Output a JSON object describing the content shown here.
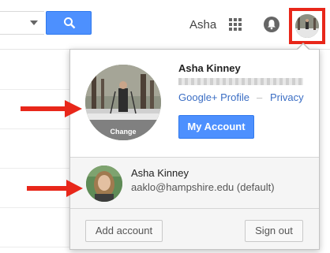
{
  "header": {
    "user_short": "Asha",
    "search_icon": "search-icon",
    "apps_icon": "apps-grid-icon",
    "notifications_icon": "bell-icon",
    "highlight_color": "#e8271a"
  },
  "account_popup": {
    "name": "Asha Kinney",
    "change_label": "Change",
    "gplus_link": "Google+ Profile",
    "separator": "–",
    "privacy_link": "Privacy",
    "my_account_label": "My Account",
    "accent_color": "#4d90fe"
  },
  "secondary_account": {
    "name": "Asha Kinney",
    "email": "aaklo@hampshire.edu (default)"
  },
  "footer": {
    "add_account_label": "Add account",
    "sign_out_label": "Sign out"
  },
  "annotations": {
    "arrow_color": "#e8271a"
  }
}
